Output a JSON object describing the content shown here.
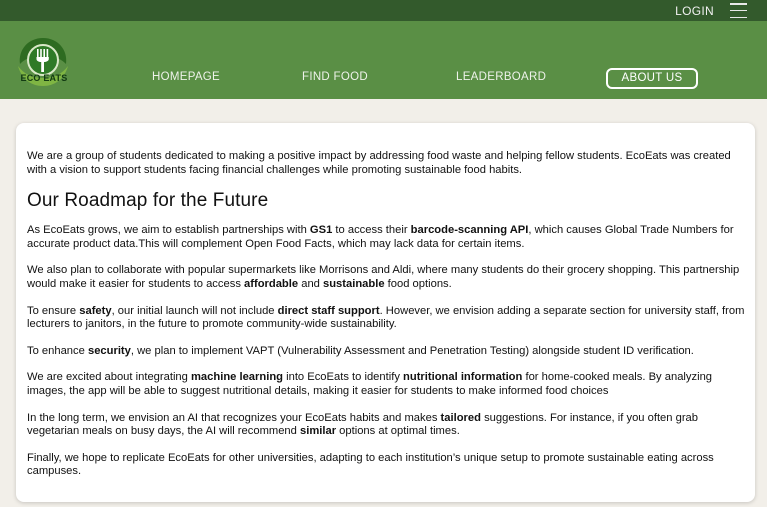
{
  "topbar": {
    "login_label": "LOGIN"
  },
  "brand": {
    "logo_text": "ECO EATS"
  },
  "nav": {
    "homepage": "HOMEPAGE",
    "find_food": "FIND FOOD",
    "leaderboard": "LEADERBOARD",
    "about_us": "ABOUT US"
  },
  "colors": {
    "topbar": "#335a2c",
    "navbar": "#5a8f45",
    "background": "#f2efe9"
  },
  "content": {
    "intro": "We are a group of students dedicated to making a positive impact by addressing food waste and helping fellow students. EcoEats was created with a vision to support students facing financial challenges while promoting sustainable food habits.",
    "heading": "Our Roadmap for the Future",
    "p1": {
      "a": "As EcoEats grows, we aim to establish partnerships with ",
      "b1": "GS1",
      "c": " to access their ",
      "b2": "barcode-scanning API",
      "d": ", which causes Global Trade Numbers for accurate product data.This will complement Open Food Facts, which may lack data for certain items."
    },
    "p2": {
      "a": "We also plan to collaborate with popular supermarkets like Morrisons and Aldi, where many students do their grocery shopping. This partnership would make it easier for students to access ",
      "b1": "affordable",
      "c": " and ",
      "b2": "sustainable",
      "d": " food options."
    },
    "p3": {
      "a": "To ensure ",
      "b1": "safety",
      "c": ", our initial launch will not include ",
      "b2": "direct staff support",
      "d": ". However, we envision adding a separate section for university staff, from lecturers to janitors, in the future to promote community-wide sustainability."
    },
    "p4": {
      "a": "To enhance ",
      "b1": "security",
      "c": ", we plan to implement VAPT (Vulnerability Assessment and Penetration Testing) alongside student ID verification."
    },
    "p5": {
      "a": "We are excited about integrating ",
      "b1": "machine learning",
      "c": " into EcoEats to identify ",
      "b2": "nutritional information",
      "d": " for home-cooked meals. By analyzing images, the app will be able to suggest nutritional details, making it easier for students to make informed food choices"
    },
    "p6": {
      "a": "In the long term, we envision an AI that recognizes your EcoEats habits and makes ",
      "b1": "tailored",
      "c": " suggestions. For instance, if you often grab vegetarian meals on busy days, the AI will recommend ",
      "b2": "similar",
      "d": " options at optimal times."
    },
    "p7": "Finally, we hope to replicate EcoEats for other universities, adapting to each institution’s unique setup to promote sustainable eating across campuses."
  }
}
